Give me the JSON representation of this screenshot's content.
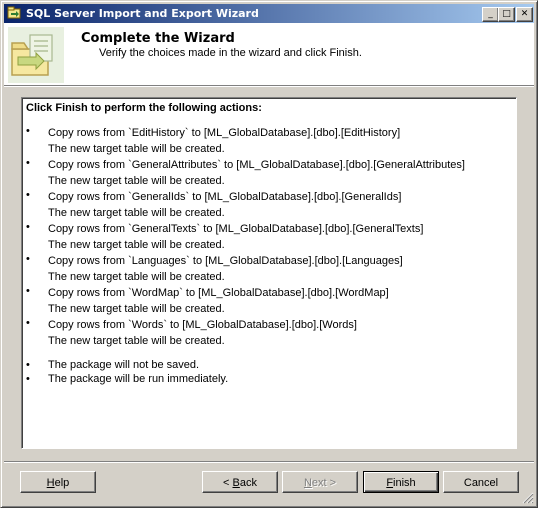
{
  "window": {
    "title": "SQL Server Import and Export Wizard",
    "controls": {
      "minimize": "_",
      "maximize": "□",
      "close": "✕"
    }
  },
  "header": {
    "title": "Complete the Wizard",
    "subtitle": "Verify the choices made in the wizard and click Finish."
  },
  "summary": {
    "heading": "Click Finish to perform the following actions:",
    "bullet": "•",
    "actions": [
      {
        "copy": "Copy rows from `EditHistory` to [ML_GlobalDatabase].[dbo].[EditHistory]",
        "note": "The new target table will be created."
      },
      {
        "copy": "Copy rows from `GeneralAttributes` to [ML_GlobalDatabase].[dbo].[GeneralAttributes]",
        "note": "The new target table will be created."
      },
      {
        "copy": "Copy rows from `GeneralIds` to [ML_GlobalDatabase].[dbo].[GeneralIds]",
        "note": "The new target table will be created."
      },
      {
        "copy": "Copy rows from `GeneralTexts` to [ML_GlobalDatabase].[dbo].[GeneralTexts]",
        "note": "The new target table will be created."
      },
      {
        "copy": "Copy rows from `Languages` to [ML_GlobalDatabase].[dbo].[Languages]",
        "note": "The new target table will be created."
      },
      {
        "copy": "Copy rows from `WordMap` to [ML_GlobalDatabase].[dbo].[WordMap]",
        "note": "The new target table will be created."
      },
      {
        "copy": "Copy rows from `Words` to [ML_GlobalDatabase].[dbo].[Words]",
        "note": "The new target table will be created."
      }
    ],
    "notes": [
      "The package will not be saved.",
      "The package will be run immediately."
    ]
  },
  "buttons": {
    "help": {
      "pre": "",
      "key": "H",
      "post": "elp"
    },
    "back": {
      "pre": "< ",
      "key": "B",
      "post": "ack"
    },
    "next": {
      "pre": "",
      "key": "N",
      "post": "ext >"
    },
    "finish": {
      "pre": "",
      "key": "F",
      "post": "inish"
    },
    "cancel": "Cancel"
  }
}
